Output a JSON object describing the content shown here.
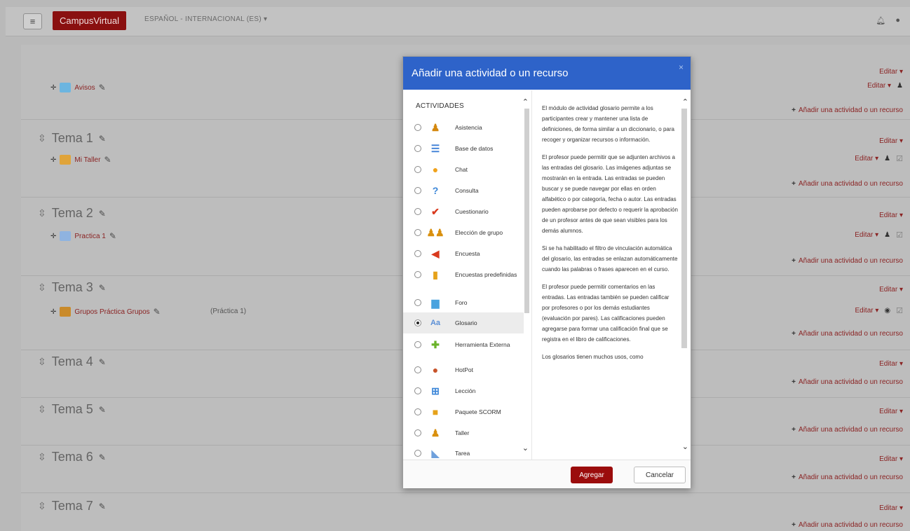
{
  "navbar": {
    "menu_icon": "hamburger-icon",
    "brand": "CampusVirtual",
    "language": "ESPAÑOL - INTERNACIONAL (ES) ▾",
    "icons": [
      "bell-icon",
      "chat-icon"
    ]
  },
  "course": {
    "editar": "Editar ▾",
    "add_activity": "Añadir una actividad o un recurso",
    "avisos": "Avisos",
    "sections": [
      {
        "title": "Tema 1",
        "activity": "Mi Taller"
      },
      {
        "title": "Tema 2",
        "activity": "Practica 1"
      },
      {
        "title": "Tema 3",
        "activity": "Grupos Práctica Grupos",
        "note": "(Práctica 1)"
      },
      {
        "title": "Tema 4"
      },
      {
        "title": "Tema 5"
      },
      {
        "title": "Tema 6"
      },
      {
        "title": "Tema 7"
      }
    ]
  },
  "modal": {
    "title": "Añadir una actividad o un recurso",
    "close": "×",
    "list_heading": "ACTIVIDADES",
    "options": [
      {
        "label": "Asistencia",
        "icon": "attendance-icon"
      },
      {
        "label": "Base de datos",
        "icon": "database-icon"
      },
      {
        "label": "Chat",
        "icon": "chat-bubble-icon"
      },
      {
        "label": "Consulta",
        "icon": "question-icon"
      },
      {
        "label": "Cuestionario",
        "icon": "quiz-checkmark-icon"
      },
      {
        "label": "Elección de grupo",
        "icon": "group-choice-icon"
      },
      {
        "label": "Encuesta",
        "icon": "survey-megaphone-icon"
      },
      {
        "label": "Encuestas predefinidas",
        "icon": "bar-chart-icon"
      },
      {
        "label": "Foro",
        "icon": "forum-icon"
      },
      {
        "label": "Glosario",
        "icon": "glossary-icon"
      },
      {
        "label": "Herramienta Externa",
        "icon": "puzzle-icon"
      },
      {
        "label": "HotPot",
        "icon": "hotpot-icon"
      },
      {
        "label": "Lección",
        "icon": "lesson-icon"
      },
      {
        "label": "Paquete SCORM",
        "icon": "scorm-package-icon"
      },
      {
        "label": "Taller",
        "icon": "workshop-icon"
      },
      {
        "label": "Tarea",
        "icon": "assignment-icon"
      }
    ],
    "selected": "Glosario",
    "description": [
      "El módulo de actividad glosario permite a los participantes crear y mantener una lista de definiciones, de forma similar a un diccionario, o para recoger y organizar recursos o información.",
      "El profesor puede permitir que se adjunten archivos a las entradas del glosario. Las imágenes adjuntas se mostrarán en la entrada. Las entradas se pueden buscar y se puede navegar por ellas en orden alfabético o por categoría, fecha o autor. Las entradas pueden aprobarse por defecto o requerir la aprobación de un profesor antes de que sean visibles para los demás alumnos.",
      "Si se ha habilitado el filtro de vinculación automática del glosario, las entradas se enlazan automáticamente cuando las palabras o frases aparecen en el curso.",
      "El profesor puede permitir comentarios en las entradas. Las entradas también se pueden calificar por profesores o por los demás estudiantes (evaluación por pares). Las calificaciones pueden agregarse para formar una calificación final que se registra en el libro de calificaciones.",
      "Los glosarios tienen muchos usos, como"
    ],
    "btn_add": "Agregar",
    "btn_cancel": "Cancelar"
  }
}
